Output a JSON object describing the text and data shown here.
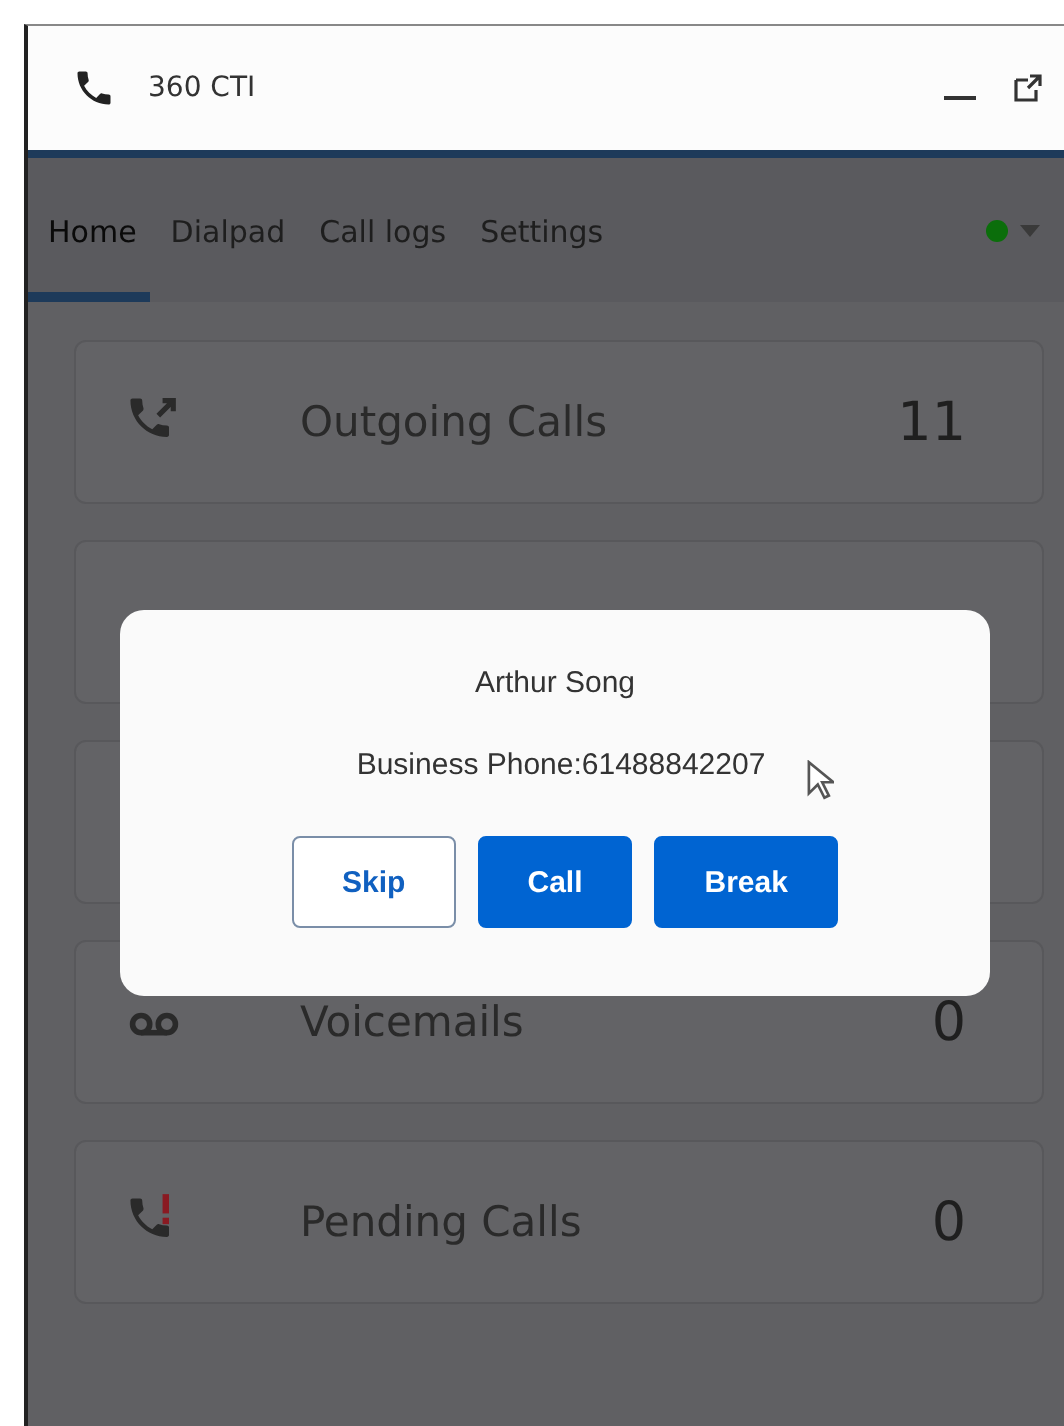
{
  "window": {
    "title": "360 CTI"
  },
  "tabs": [
    {
      "label": "Home",
      "selected": true
    },
    {
      "label": "Dialpad",
      "selected": false
    },
    {
      "label": "Call logs",
      "selected": false
    },
    {
      "label": "Settings",
      "selected": false
    }
  ],
  "cards": [
    {
      "kind": "outgoing",
      "label": "Outgoing Calls",
      "count": "11"
    },
    {
      "kind": "blank"
    },
    {
      "kind": "blank"
    },
    {
      "kind": "voicemail",
      "label": "Voicemails",
      "count": "0"
    },
    {
      "kind": "pending",
      "label": "Pending Calls",
      "count": "0"
    }
  ],
  "dialog": {
    "name": "Arthur Song",
    "phone": "Business Phone:61488842207",
    "buttons": [
      {
        "kind": "outline",
        "label": "Skip"
      },
      {
        "kind": "primary",
        "label": "Call"
      },
      {
        "kind": "primary",
        "label": "Break"
      }
    ]
  }
}
